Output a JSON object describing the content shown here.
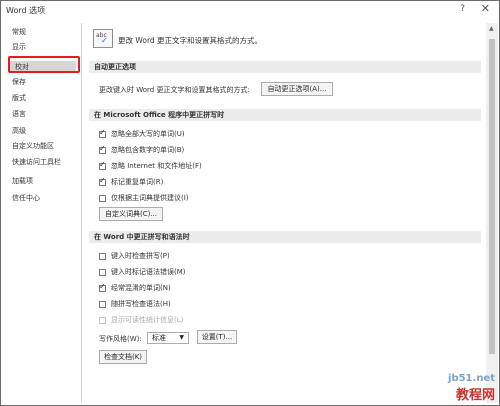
{
  "window": {
    "title": "Word 选项",
    "help": "?",
    "close": "✕"
  },
  "sidebar": {
    "items": [
      {
        "label": "常规"
      },
      {
        "label": "显示"
      },
      {
        "label": "校对",
        "selected": true
      },
      {
        "label": "保存"
      },
      {
        "label": "版式"
      },
      {
        "label": "语言"
      },
      {
        "label": "高级"
      },
      {
        "label": "自定义功能区"
      },
      {
        "label": "快速访问工具栏"
      },
      {
        "label": "加载项"
      },
      {
        "label": "信任中心"
      }
    ]
  },
  "main": {
    "header_icon_text": "abc",
    "header_text": "更改 Word 更正文字和设置其格式的方式。",
    "autocorrect": {
      "title": "自动更正选项",
      "desc": "更改键入时 Word 更正文字和设置其格式的方式:",
      "button": "自动更正选项(A)..."
    },
    "office": {
      "title": "在 Microsoft Office 程序中更正拼写时",
      "options": [
        {
          "label": "忽略全部大写的单词(U)",
          "checked": true
        },
        {
          "label": "忽略包含数字的单词(B)",
          "checked": true
        },
        {
          "label": "忽略 Internet 和文件地址(F)",
          "checked": true
        },
        {
          "label": "标记重复单词(R)",
          "checked": true
        },
        {
          "label": "仅根据主词典提供建议(I)",
          "checked": false
        }
      ],
      "dict_button": "自定义词典(C)..."
    },
    "word": {
      "title": "在 Word 中更正拼写和语法时",
      "options": [
        {
          "label": "键入时检查拼写(P)",
          "checked": false,
          "disabled": false
        },
        {
          "label": "键入时标记语法错误(M)",
          "checked": false,
          "disabled": false
        },
        {
          "label": "经常混淆的单词(N)",
          "checked": true,
          "disabled": false
        },
        {
          "label": "随拼写检查语法(H)",
          "checked": false,
          "disabled": false
        },
        {
          "label": "显示可读性统计信息(L)",
          "checked": false,
          "disabled": true
        }
      ],
      "style_label": "写作风格(W):",
      "style_value": "标准",
      "settings_button": "设置(T)...",
      "check_button": "检查文档(K)"
    }
  },
  "watermark": {
    "url": "jb51.net",
    "name": "教程网"
  }
}
